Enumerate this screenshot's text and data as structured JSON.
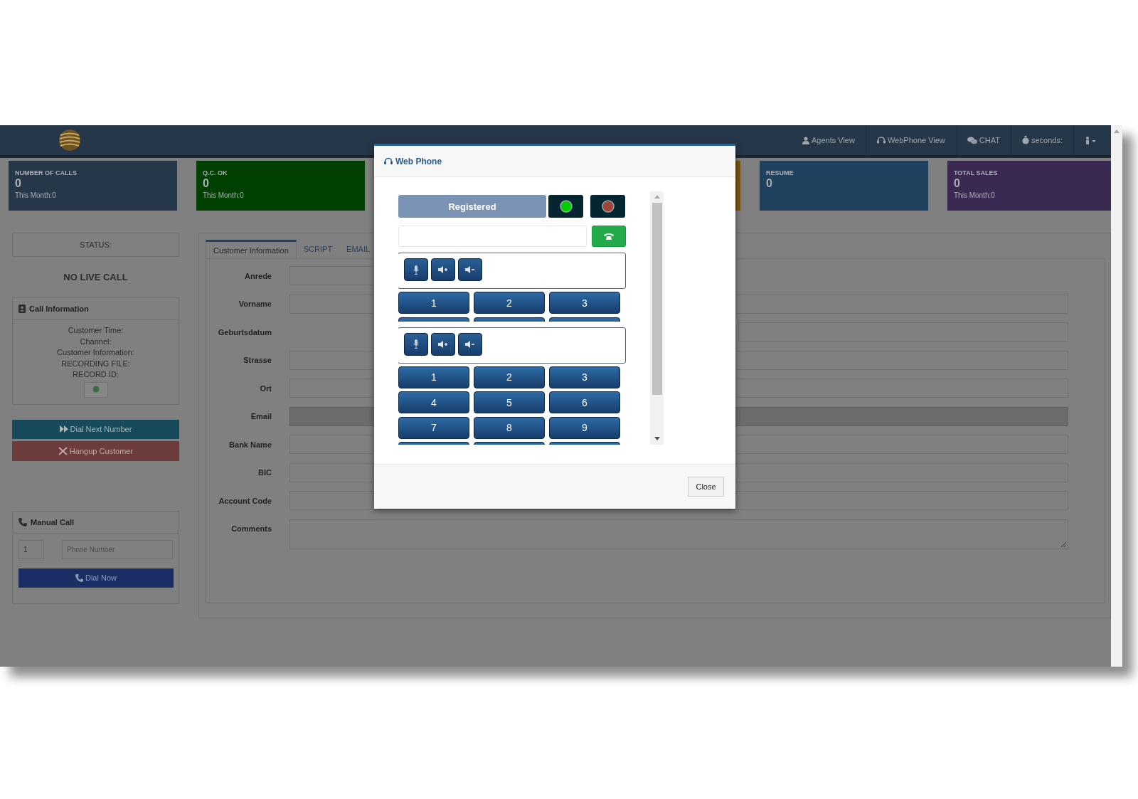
{
  "navbar": {
    "items": [
      {
        "label": "Agents View"
      },
      {
        "label": "WebPhone View"
      },
      {
        "label": "CHAT"
      },
      {
        "label": "seconds:"
      }
    ]
  },
  "stat_cards": [
    {
      "title": "NUMBER OF CALLS",
      "value": "0",
      "subtitle": "This Month:0",
      "color": "#26374a"
    },
    {
      "title": "Q.C. OK",
      "value": "0",
      "subtitle": "This Month:0",
      "color": "#004000"
    },
    {
      "color": "#7a5614"
    },
    {
      "title": "RESUME",
      "value": "0",
      "color": "#21425f"
    },
    {
      "title": "TOTAL SALES",
      "value": "0",
      "subtitle": "This Month:0",
      "color": "#3a2a52"
    }
  ],
  "status_panel": {
    "status_label": "STATUS:",
    "live_call": "NO LIVE CALL"
  },
  "call_information": {
    "title": "Call Information",
    "lines": [
      "Customer Time:",
      "Channel:",
      "Customer Information:",
      "RECORDING FILE:",
      "RECORD ID:"
    ]
  },
  "actions": [
    {
      "label": "Dial Next Number",
      "kind": "next"
    },
    {
      "label": "Hangup Customer",
      "kind": "hangup"
    }
  ],
  "manual_call": {
    "title": "Manual Call",
    "prefix_value": "1",
    "phone_placeholder": "Phone Number",
    "dial_label": "Dial Now"
  },
  "tabs": [
    {
      "label": "Customer Information",
      "selected": true
    },
    {
      "label": "SCRIPT",
      "selected": false
    },
    {
      "label": "EMAIL",
      "selected": false
    }
  ],
  "form_fields": [
    {
      "label": "Anrede",
      "kind": "select",
      "disabled": false
    },
    {
      "label": "Vorname",
      "kind": "text",
      "disabled": false
    },
    {
      "label": "Geburtsdatum",
      "kind": "date",
      "disabled": false
    },
    {
      "label": "Strasse",
      "kind": "text",
      "disabled": false
    },
    {
      "label": "Ort",
      "kind": "text",
      "disabled": false
    },
    {
      "label": "Email",
      "kind": "text",
      "disabled": true
    },
    {
      "label": "Bank Name",
      "kind": "text",
      "disabled": false
    },
    {
      "label": "BIC",
      "kind": "text",
      "disabled": false
    },
    {
      "label": "Account Code",
      "kind": "text",
      "disabled": false
    },
    {
      "label": "Comments",
      "kind": "textarea",
      "disabled": false
    }
  ],
  "web_phone": {
    "title": "Web Phone",
    "status": "Registered",
    "lights": [
      {
        "color": "#00cc00"
      },
      {
        "color": "#a0443a"
      }
    ],
    "panels": [
      {
        "keys": [
          "1",
          "2",
          "3"
        ]
      },
      {
        "keys": [
          "1",
          "2",
          "3",
          "4",
          "5",
          "6",
          "7",
          "8",
          "9"
        ]
      }
    ],
    "close_label": "Close"
  }
}
